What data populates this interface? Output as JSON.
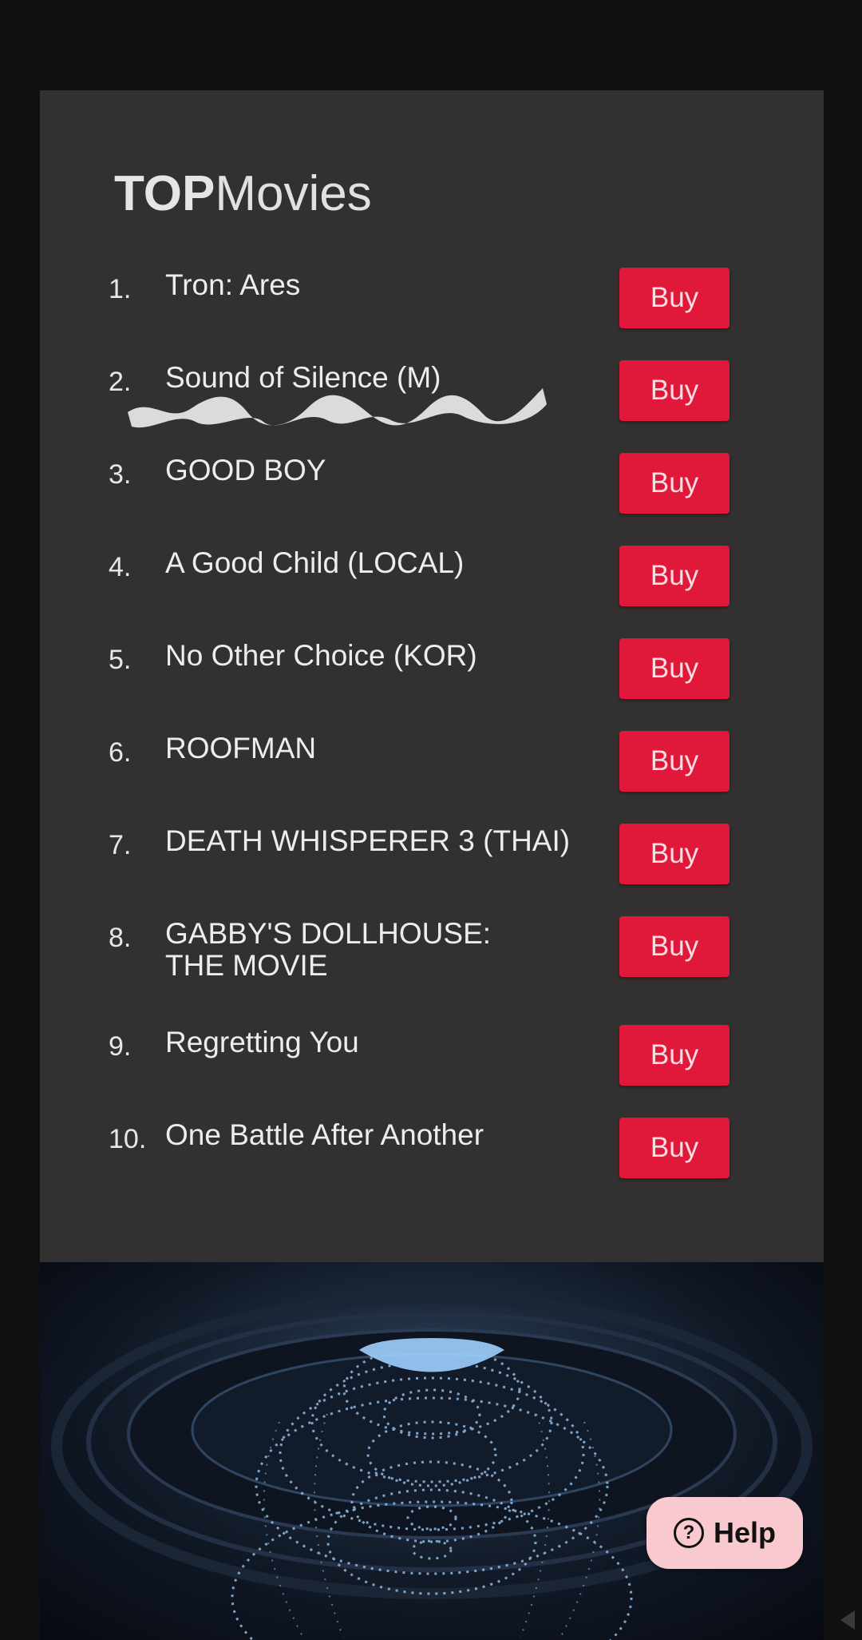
{
  "header": {
    "title_bold": "TOP",
    "title_light": "Movies"
  },
  "movies": [
    {
      "rank": "1.",
      "title": "Tron: Ares",
      "button": "Buy"
    },
    {
      "rank": "2.",
      "title": "Sound of Silence (M)",
      "button": "Buy"
    },
    {
      "rank": "3.",
      "title": "GOOD BOY",
      "button": "Buy"
    },
    {
      "rank": "4.",
      "title": "A Good Child (LOCAL)",
      "button": "Buy"
    },
    {
      "rank": "5.",
      "title": "No Other Choice (KOR)",
      "button": "Buy"
    },
    {
      "rank": "6.",
      "title": "ROOFMAN",
      "button": "Buy"
    },
    {
      "rank": "7.",
      "title": "DEATH WHISPERER 3 (THAI)",
      "button": "Buy"
    },
    {
      "rank": "8.",
      "title": "GABBY'S DOLLHOUSE: THE MOVIE",
      "button": "Buy"
    },
    {
      "rank": "9.",
      "title": "Regretting You",
      "button": "Buy"
    },
    {
      "rank": "10.",
      "title": "One Battle After Another",
      "button": "Buy"
    }
  ],
  "help_button": {
    "icon": "question-circle-icon",
    "label": "Help"
  },
  "colors": {
    "panel_bg": "#333032",
    "buy_button": "#e0193a",
    "help_button": "#f8c9cf",
    "page_bg": "#101010"
  }
}
